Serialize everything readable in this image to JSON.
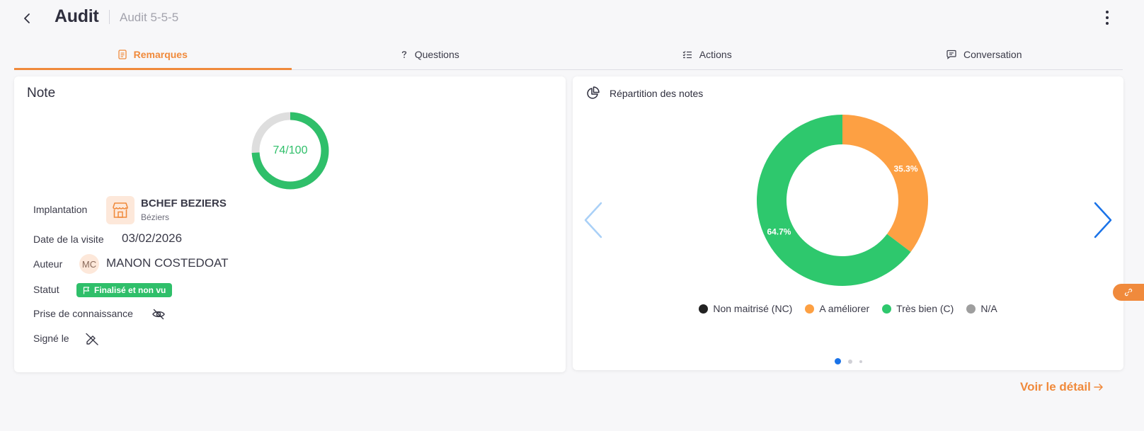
{
  "header": {
    "title": "Audit",
    "subtitle": "Audit 5-5-5"
  },
  "tabs": [
    {
      "label": "Remarques",
      "icon": "document-icon",
      "active": true
    },
    {
      "label": "Questions",
      "icon": "question-icon",
      "active": false
    },
    {
      "label": "Actions",
      "icon": "checklist-icon",
      "active": false
    },
    {
      "label": "Conversation",
      "icon": "chat-icon",
      "active": false
    }
  ],
  "note": {
    "title": "Note",
    "score_text": "74/100",
    "score": 74,
    "score_max": 100,
    "score_color": "#2fbf6a",
    "fields": {
      "implantation_label": "Implantation",
      "implantation_name": "BCHEF BEZIERS",
      "implantation_city": "Béziers",
      "date_label": "Date de la visite",
      "date_value": "03/02/2026",
      "author_label": "Auteur",
      "author_initials": "MC",
      "author_name": "MANON COSTEDOAT",
      "status_label": "Statut",
      "status_value": "Finalisé et non vu",
      "prise_label": "Prise de connaissance",
      "signe_label": "Signé le"
    }
  },
  "chart": {
    "title": "Répartition des notes"
  },
  "chart_data": {
    "type": "pie",
    "donut": true,
    "categories": [
      "Non maitrisé (NC)",
      "A améliorer",
      "Très bien (C)",
      "N/A"
    ],
    "values": [
      0,
      35.3,
      64.7,
      0
    ],
    "labels": [
      "",
      "35.3%",
      "64.7%",
      ""
    ],
    "colors": [
      "#222222",
      "#fda043",
      "#2ec86d",
      "#9e9e9e"
    ],
    "legend": "bottom"
  },
  "carousel": {
    "pages": 3,
    "active": 1
  },
  "footer": {
    "voir_detail": "Voir le détail"
  },
  "colors": {
    "accent": "#f08a3c",
    "success": "#2fbf6a",
    "nav_blue": "#1a73e8"
  }
}
